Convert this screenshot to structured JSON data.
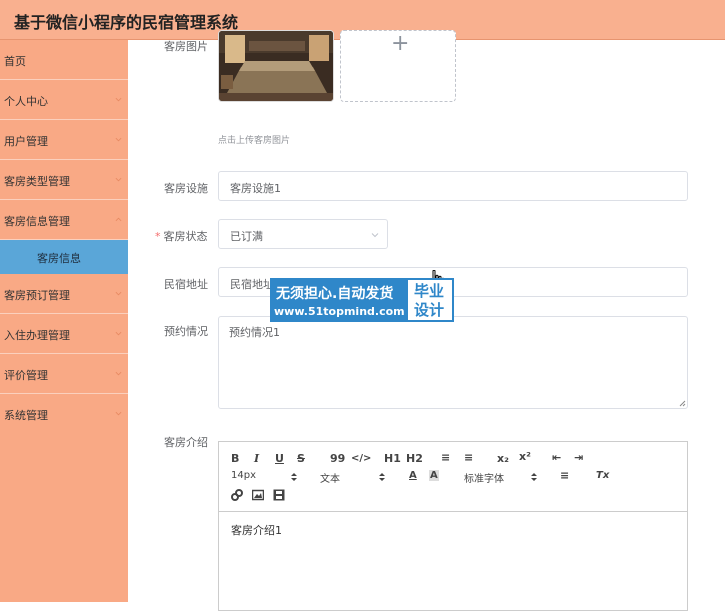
{
  "app": {
    "title": "基于微信小程序的民宿管理系统"
  },
  "sidebar": {
    "items": [
      {
        "label": "首页",
        "has_arrow": false
      },
      {
        "label": "个人中心",
        "has_arrow": true
      },
      {
        "label": "用户管理",
        "has_arrow": true
      },
      {
        "label": "客房类型管理",
        "has_arrow": true
      },
      {
        "label": "客房信息管理",
        "has_arrow": true
      },
      {
        "label": "客房预订管理",
        "has_arrow": true
      },
      {
        "label": "入住办理管理",
        "has_arrow": true
      },
      {
        "label": "评价管理",
        "has_arrow": true
      },
      {
        "label": "系统管理",
        "has_arrow": true
      }
    ],
    "active_sub": "客房信息"
  },
  "form": {
    "photo_label": "客房图片",
    "upload_plus": "+",
    "upload_tip": "点击上传客房图片",
    "facility_label": "客房设施",
    "facility_value": "客房设施1",
    "status_label": "客房状态",
    "status_required": "*",
    "status_value": "已订满",
    "address_label": "民宿地址",
    "address_value": "民宿地址1",
    "booking_label": "预约情况",
    "booking_value": "预约情况1",
    "intro_label": "客房介绍",
    "intro_value": "客房介绍1"
  },
  "editor": {
    "bold": "B",
    "italic": "I",
    "underline": "U",
    "strike": "S",
    "quote": "99",
    "code": "</>",
    "h1": "H1",
    "h2": "H2",
    "ordered_list": "≡",
    "bullet_list": "≡",
    "subscript": "x₂",
    "superscript": "x²",
    "outdent": "⇤",
    "indent": "⇥",
    "font_size": "14px",
    "header_select": "文本",
    "font_color": "A",
    "bg_color": "A",
    "font_family": "标准字体",
    "align": "≡",
    "clean": "Tx"
  },
  "watermark": {
    "line1": "无须担心.自动发货",
    "line2": "www.51topmind.com",
    "badge": "毕业设计"
  }
}
